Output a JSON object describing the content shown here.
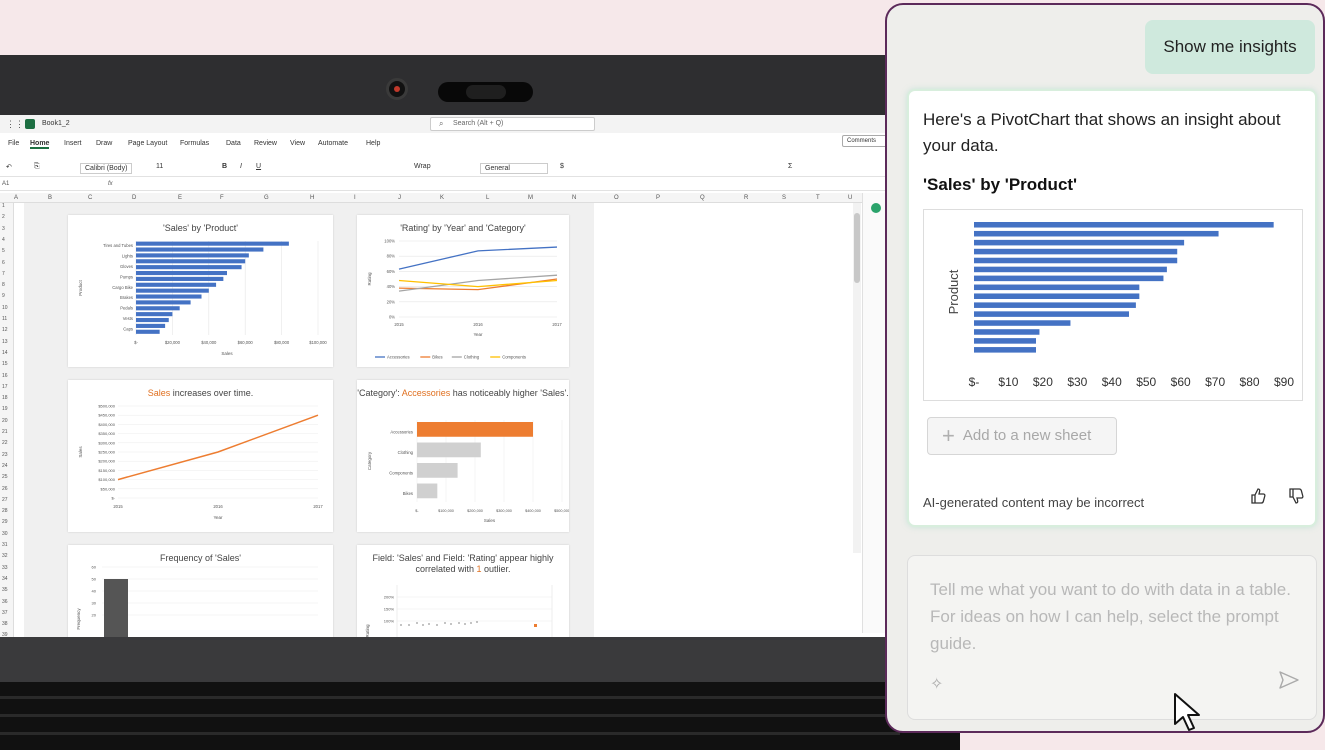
{
  "excel": {
    "book_name": "Book1_2",
    "search_placeholder": "Search (Alt + Q)",
    "menu": [
      "File",
      "Home",
      "Insert",
      "Draw",
      "Page Layout",
      "Formulas",
      "Data",
      "Review",
      "View",
      "Automate",
      "Help"
    ],
    "comments_label": "Comments",
    "font_name": "Calibri (Body)",
    "font_size": "11",
    "wrap_label": "Wrap",
    "number_format": "General",
    "name_box": "A1",
    "fx": "fx",
    "columns": [
      "A",
      "B",
      "C",
      "D",
      "E",
      "F",
      "G",
      "H",
      "I",
      "J",
      "K",
      "L",
      "M",
      "N",
      "O",
      "P",
      "Q",
      "R",
      "S",
      "T",
      "U"
    ],
    "rows": [
      "1",
      "2",
      "3",
      "4",
      "5",
      "6",
      "7",
      "8",
      "9",
      "10",
      "11",
      "12",
      "13",
      "14",
      "15",
      "16",
      "17",
      "18",
      "19",
      "20",
      "21",
      "22",
      "23",
      "24",
      "25",
      "26",
      "27",
      "28",
      "29",
      "30",
      "31",
      "32",
      "33",
      "34",
      "35",
      "36",
      "37",
      "38",
      "39"
    ]
  },
  "sheet_cards": {
    "c1_title": "'Sales' by 'Product'",
    "c2_title": "'Rating' by 'Year' and 'Category'",
    "c3_title_hl": "Sales",
    "c3_title_rest": " increases over time.",
    "c4_title_a": "'Category': ",
    "c4_title_hl": "Accessories",
    "c4_title_b": " has noticeably higher 'Sales'.",
    "c5_title": "Frequency of 'Sales'",
    "c6_title_a": "Field: 'Sales' and Field: 'Rating' appear highly correlated with ",
    "c6_title_hl": "1",
    "c6_title_b": " outlier."
  },
  "chart_data": [
    {
      "type": "bar",
      "title": "'Sales' by 'Product'",
      "categories": [
        "Tires and Tubes",
        "Lights",
        "Gloves",
        "Pumps",
        "Cargo Bike",
        "Brakes",
        "Pedals",
        "Vests",
        "Caps"
      ],
      "values": [
        84000,
        70000,
        62000,
        60000,
        58000,
        50000,
        48000,
        44000,
        40000,
        36000,
        30000,
        24000,
        20000,
        18000,
        16000,
        13000
      ],
      "xlabel": "Sales",
      "ylabel": "Product",
      "xticks": [
        "$-",
        "$20,000",
        "$40,000",
        "$60,000",
        "$80,000",
        "$100,000"
      ],
      "xlim": [
        0,
        100000
      ]
    },
    {
      "type": "line",
      "title": "'Rating' by 'Year' and 'Category'",
      "x": [
        "2015",
        "2016",
        "2017"
      ],
      "series": [
        {
          "name": "Accessories",
          "values": [
            63,
            87,
            92
          ],
          "color": "#4472c4"
        },
        {
          "name": "Bikes",
          "values": [
            38,
            36,
            50
          ],
          "color": "#ed7d31"
        },
        {
          "name": "Clothing",
          "values": [
            34,
            48,
            55
          ],
          "color": "#a5a5a5"
        },
        {
          "name": "Components",
          "values": [
            48,
            40,
            48
          ],
          "color": "#ffc000"
        }
      ],
      "xlabel": "Year",
      "ylabel": "Rating",
      "yticks": [
        "0%",
        "20%",
        "40%",
        "60%",
        "80%",
        "100%"
      ],
      "ylim": [
        0,
        100
      ]
    },
    {
      "type": "line",
      "title": "Sales increases over time.",
      "x": [
        "2015",
        "2016",
        "2017"
      ],
      "series": [
        {
          "values": [
            100000,
            250000,
            450000
          ],
          "color": "#ed7d31"
        }
      ],
      "xlabel": "Year",
      "ylabel": "Sales",
      "yticks": [
        "$-",
        "$50,000",
        "$100,000",
        "$150,000",
        "$200,000",
        "$250,000",
        "$300,000",
        "$350,000",
        "$400,000",
        "$450,000",
        "$500,000"
      ],
      "ylim": [
        0,
        500000
      ]
    },
    {
      "type": "bar",
      "title": "'Category': Accessories has noticeably higher 'Sales'.",
      "categories": [
        "Accessories",
        "Clothing",
        "Components",
        "Bikes"
      ],
      "values": [
        400000,
        220000,
        140000,
        70000
      ],
      "colors": [
        "#ed7d31",
        "#d0d0d0",
        "#d0d0d0",
        "#d0d0d0"
      ],
      "xlabel": "Sales",
      "ylabel": "Category",
      "xticks": [
        "$-",
        "$100,000",
        "$200,000",
        "$300,000",
        "$400,000",
        "$500,000"
      ],
      "xlim": [
        0,
        500000
      ]
    },
    {
      "type": "bar",
      "title": "Frequency of 'Sales'",
      "values": [
        50
      ],
      "ylabel": "Frequency",
      "yticks": [
        "20",
        "30",
        "40",
        "50",
        "60"
      ],
      "ylim": [
        0,
        60
      ]
    },
    {
      "type": "scatter",
      "title": "Field: 'Sales' and Field: 'Rating' appear highly correlated with 1 outlier.",
      "ylabel": "Rating",
      "yticks": [
        "100%",
        "150%",
        "200%"
      ]
    },
    {
      "type": "bar",
      "title": "'Sales' by 'Product'",
      "values": [
        87,
        71,
        61,
        59,
        59,
        56,
        55,
        48,
        48,
        47,
        45,
        28,
        19,
        18,
        18
      ],
      "ylabel": "Product",
      "xticks": [
        "$-",
        "$10",
        "$20",
        "$30",
        "$40",
        "$50",
        "$60",
        "$70",
        "$80",
        "$90"
      ],
      "xlim": [
        0,
        90
      ],
      "color": "#4472c4"
    }
  ],
  "copilot": {
    "user_message": "Show me insights",
    "reply_text": "Here's a PivotChart that shows an insight about your data.",
    "reply_title": "'Sales' by 'Product'",
    "add_button": "Add to a new sheet",
    "disclaimer": "AI-generated content may be incorrect",
    "input_placeholder": "Tell me what you want to do with data in a table. For ideas on how I can help, select the prompt guide."
  },
  "colors": {
    "accent": "#5c2a5a",
    "bar_blue": "#4472c4",
    "orange": "#ed7d31",
    "user_bubble": "#cfe9dd"
  }
}
